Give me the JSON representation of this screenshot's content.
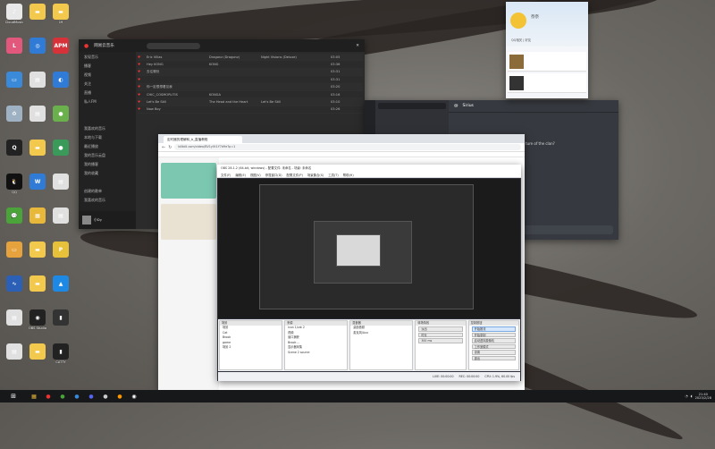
{
  "desktop": {
    "icons": [
      {
        "label": "CloudMusic",
        "color": "#e8e8e8",
        "glyph": "♪",
        "col": 0,
        "row": 0
      },
      {
        "label": "",
        "color": "#f2c94c",
        "glyph": "▬",
        "col": 1,
        "row": 0
      },
      {
        "label": "19",
        "color": "#f2c94c",
        "glyph": "▬",
        "col": 2,
        "row": 0
      },
      {
        "label": "",
        "color": "#e2577c",
        "glyph": "L",
        "col": 0,
        "row": 1
      },
      {
        "label": "",
        "color": "#2f7bd6",
        "glyph": "◎",
        "col": 1,
        "row": 1
      },
      {
        "label": "",
        "color": "#d7323a",
        "glyph": "APM",
        "col": 2,
        "row": 1
      },
      {
        "label": "",
        "color": "#3b8ad9",
        "glyph": "▭",
        "col": 0,
        "row": 2
      },
      {
        "label": "",
        "color": "#e0e0e0",
        "glyph": "▤",
        "col": 1,
        "row": 2
      },
      {
        "label": "",
        "color": "#2f7bd6",
        "glyph": "◐",
        "col": 2,
        "row": 2
      },
      {
        "label": "",
        "color": "#9fb2c4",
        "glyph": "♻",
        "col": 0,
        "row": 3
      },
      {
        "label": "",
        "color": "#e0e0e0",
        "glyph": "▤",
        "col": 1,
        "row": 3
      },
      {
        "label": "",
        "color": "#6ab04c",
        "glyph": "●",
        "col": 2,
        "row": 3
      },
      {
        "label": "",
        "color": "#222",
        "glyph": "Q",
        "col": 0,
        "row": 4
      },
      {
        "label": "",
        "color": "#f2c94c",
        "glyph": "▬",
        "col": 1,
        "row": 4
      },
      {
        "label": "",
        "color": "#3a9a59",
        "glyph": "●",
        "col": 2,
        "row": 4
      },
      {
        "label": "QQ",
        "color": "#111",
        "glyph": "🐧",
        "col": 0,
        "row": 5
      },
      {
        "label": "",
        "color": "#2f7bd6",
        "glyph": "W",
        "col": 1,
        "row": 5
      },
      {
        "label": "",
        "color": "#e0e0e0",
        "glyph": "▤",
        "col": 2,
        "row": 5
      },
      {
        "label": "",
        "color": "#4aa43a",
        "glyph": "💬",
        "col": 0,
        "row": 6
      },
      {
        "label": "",
        "color": "#e8b83a",
        "glyph": "▦",
        "col": 1,
        "row": 6
      },
      {
        "label": "",
        "color": "#e0e0e0",
        "glyph": "▤",
        "col": 2,
        "row": 6
      },
      {
        "label": "",
        "color": "#e6a23c",
        "glyph": "▭",
        "col": 0,
        "row": 7
      },
      {
        "label": "",
        "color": "#f2c94c",
        "glyph": "▬",
        "col": 1,
        "row": 7
      },
      {
        "label": "",
        "color": "#e8c13a",
        "glyph": "P",
        "col": 2,
        "row": 7
      },
      {
        "label": "",
        "color": "#2c5fb6",
        "glyph": "∿",
        "col": 0,
        "row": 8
      },
      {
        "label": "",
        "color": "#f2c94c",
        "glyph": "▬",
        "col": 1,
        "row": 8
      },
      {
        "label": "",
        "color": "#1e88e5",
        "glyph": "▲",
        "col": 2,
        "row": 8
      },
      {
        "label": "",
        "color": "#e0e0e0",
        "glyph": "▤",
        "col": 0,
        "row": 9
      },
      {
        "label": "OBS Studio",
        "color": "#222",
        "glyph": "◉",
        "col": 1,
        "row": 9
      },
      {
        "label": "",
        "color": "#333",
        "glyph": "▮",
        "col": 2,
        "row": 9
      },
      {
        "label": "",
        "color": "#e0e0e0",
        "glyph": "▤",
        "col": 0,
        "row": 10
      },
      {
        "label": "",
        "color": "#f2c94c",
        "glyph": "▬",
        "col": 1,
        "row": 10
      },
      {
        "label": "CATTY",
        "color": "#222",
        "glyph": "▮",
        "col": 2,
        "row": 10
      }
    ]
  },
  "music": {
    "title": "网易云音乐",
    "sidebar": [
      "发现音乐",
      "播客",
      "视频",
      "关注",
      "直播",
      "私人FM",
      "",
      "",
      "我喜欢的音乐",
      "本地与下载",
      "最近播放",
      "我的音乐云盘",
      "我的播客",
      "我的收藏",
      "",
      "创建的歌单",
      "我喜欢的音乐"
    ],
    "rows": [
      {
        "name": "Eric Villas",
        "artist": "Dragonz (Dragonz)",
        "album": "Night Visions (Deluxe)",
        "time": "03:05"
      },
      {
        "name": "Hey KONG",
        "artist": "KONG",
        "album": "",
        "time": "03:36"
      },
      {
        "name": "去往哪处",
        "artist": "",
        "album": "",
        "time": "03:31"
      },
      {
        "name": "",
        "artist": "",
        "album": "",
        "time": "03:31"
      },
      {
        "name": "你一定很想看见我",
        "artist": "",
        "album": "",
        "time": "03:20"
      },
      {
        "name": "CHIC_COSMOPLITIS",
        "artist": "KONGA",
        "album": "",
        "time": "03:16"
      },
      {
        "name": "Let's Be Still",
        "artist": "The Head and the Heart",
        "album": "Let's Be Still",
        "time": "03:10"
      },
      {
        "name": "Now Boy",
        "artist": "",
        "album": "",
        "time": "03:26"
      }
    ],
    "now_playing": "小Dy"
  },
  "discord": {
    "channel": "Sirius",
    "msg": "ture of the clan?"
  },
  "qq": {
    "name": "奈奈",
    "sub": "QQ相关 | 好友"
  },
  "browser": {
    "tab_title": "定时器的理解和_b_直播教程",
    "url": "bilibili.com/video/BV1yVt1Y7d9e?p=1"
  },
  "obs": {
    "title": "OBS 28.1.2 (64-bit, windows) - 配置文件: 未命名 - 场景: 未命名",
    "menu": [
      "文件(F)",
      "编辑(E)",
      "视图(V)",
      "停靠窗口(D)",
      "配置文件(P)",
      "场景集合(S)",
      "工具(T)",
      "帮助(H)"
    ],
    "docks": {
      "scenes": {
        "title": "场景",
        "items": [
          "场景",
          "Cat",
          "Brook",
          "game",
          "场景 2"
        ]
      },
      "sources": {
        "title": "来源",
        "items": [
          "icon 1/cat 2",
          "视频",
          "窗口捕获",
          "Brook ...",
          "显示器采集",
          "Scene 2 source"
        ]
      },
      "mixer": {
        "title": "混音器",
        "items": [
          "桌面音频",
          "麦克风/Aux"
        ]
      },
      "transitions": {
        "title": "转场特效",
        "items": [
          "淡出",
          "时长",
          "300 ms"
        ]
      },
      "controls": {
        "title": "控制按钮",
        "items": [
          "开始推流",
          "开始录制",
          "启动虚拟摄像机",
          "工作室模式",
          "设置",
          "退出"
        ]
      }
    },
    "status": [
      "LIVE: 00:00:00",
      "REC: 00:00:00",
      "CPU: 1.9%, 60.00 fps"
    ]
  },
  "taskbar": {
    "time": "21:40",
    "date": "2023/2/28"
  }
}
